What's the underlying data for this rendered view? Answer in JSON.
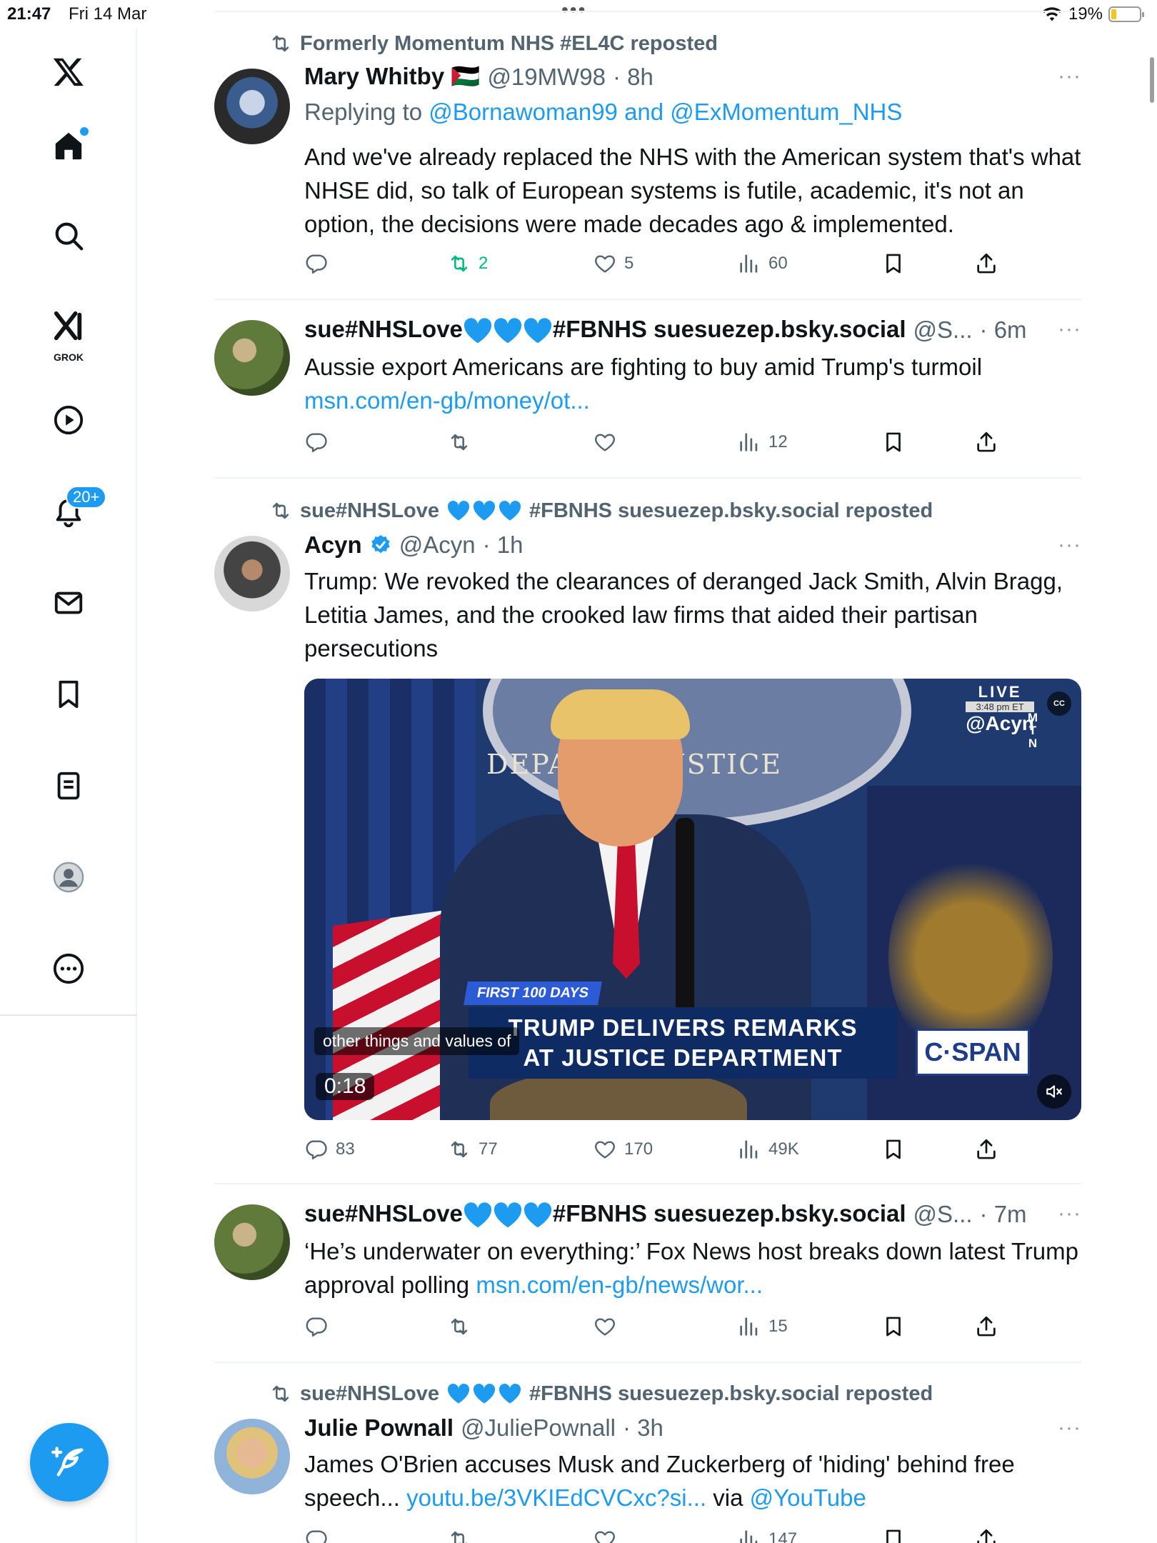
{
  "status_bar": {
    "time": "21:47",
    "date": "Fri 14 Mar",
    "battery": "19%",
    "battery_level": 0.19,
    "dots": "•••"
  },
  "sidebar": {
    "notifications_badge": "20+",
    "grok_label": "GROK"
  },
  "posts": [
    {
      "repost_by": "Formerly Momentum NHS #EL4C reposted",
      "name": "Mary Whitby 🇵🇸",
      "handle": "@19MW98",
      "time": "· 8h",
      "replying_prefix": "Replying to ",
      "replying_to": "@Bornawoman99 and @ExMomentum_NHS",
      "text": "And we've already replaced the NHS with the American system that's what NHSE did, so talk of European systems is futile, academic, it's not an option, the decisions were made decades ago & implemented.",
      "replies": "",
      "reposts": "2",
      "likes": "5",
      "views": "60"
    },
    {
      "name_a": "sue#NHSLove",
      "name_b": "#FBNHS suesuezep.bsky.social",
      "handle": "@S...",
      "time": "· 6m",
      "text": "Aussie export Americans are fighting to buy amid Trump's turmoil",
      "link": "msn.com/en-gb/money/ot...",
      "replies": "",
      "reposts": "",
      "likes": "",
      "views": "12"
    },
    {
      "repost_by_a": "sue#NHSLove",
      "repost_by_b": "#FBNHS suesuezep.bsky.social reposted",
      "name": "Acyn",
      "handle": "@Acyn",
      "time": "· 1h",
      "text": "Trump: We revoked the clearances of deranged Jack Smith, Alvin Bragg, Letitia James, and the crooked law firms that aided their partisan persecutions",
      "video": {
        "live": "LIVE",
        "live_time": "3:48 pm ET",
        "watermark": "@Acyn",
        "mtn": "M T N",
        "cc": "CC",
        "seal_text": "DEPART        F JUSTICE",
        "first_100": "FIRST 100 DAYS",
        "chyron_1": "TRUMP DELIVERS REMARKS",
        "chyron_2": "AT JUSTICE DEPARTMENT",
        "network": "C·SPAN",
        "caption": "other things and values of",
        "duration": "0:18"
      },
      "replies": "83",
      "reposts": "77",
      "likes": "170",
      "views": "49K"
    },
    {
      "name_a": "sue#NHSLove",
      "name_b": "#FBNHS suesuezep.bsky.social",
      "handle": "@S...",
      "time": "· 7m",
      "text": "‘He’s underwater on everything:’ Fox News host breaks down latest Trump approval polling ",
      "link": "msn.com/en-gb/news/wor...",
      "replies": "",
      "reposts": "",
      "likes": "",
      "views": "15"
    },
    {
      "repost_by_a": "sue#NHSLove",
      "repost_by_b": "#FBNHS suesuezep.bsky.social reposted",
      "name": "Julie Pownall",
      "handle": "@JuliePownall",
      "time": "· 3h",
      "text_a": "James O'Brien accuses Musk and Zuckerberg of 'hiding' behind free speech... ",
      "link": "youtu.be/3VKIEdCVCxc?si...",
      "text_b": " via ",
      "mention": "@YouTube",
      "views": "147"
    }
  ],
  "more_label": "···",
  "colors": {
    "accent": "#1d9bf0",
    "repost_green": "#00ba7c",
    "muted": "#536471",
    "heart_blue": "#1d9bf0"
  }
}
